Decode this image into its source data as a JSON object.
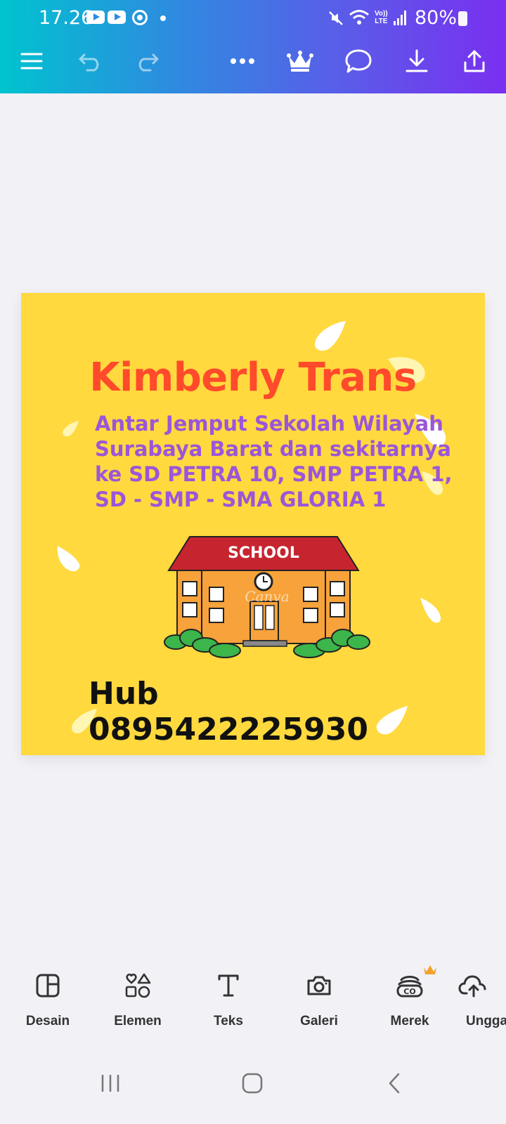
{
  "status": {
    "time": "17.26",
    "battery": "80%",
    "volte_top": "Vo))",
    "volte_bottom": "LTE"
  },
  "toolbar": {
    "menu_icon": "hamburger-icon",
    "undo_icon": "undo-icon",
    "redo_icon": "redo-icon",
    "more_icon": "more-icon",
    "crown_icon": "crown-icon",
    "comment_icon": "comment-icon",
    "download_icon": "download-icon",
    "share_icon": "share-icon"
  },
  "design": {
    "background": "#ffd93e",
    "title": "Kimberly Trans",
    "title_color": "#ff4b2b",
    "subtitle_lines": [
      "Antar Jemput Sekolah Wilayah",
      "Surabaya Barat dan sekitarnya",
      "ke SD PETRA 10, SMP PETRA 1,",
      "SD - SMP - SMA GLORIA 1"
    ],
    "subtitle_color": "#9b56d9",
    "school_sign": "SCHOOL",
    "watermark": "Canva",
    "phone": "Hub 0895422225930"
  },
  "bottom_bar": {
    "items": [
      {
        "label": "Desain",
        "icon": "layout-icon"
      },
      {
        "label": "Elemen",
        "icon": "shapes-icon"
      },
      {
        "label": "Teks",
        "icon": "text-icon"
      },
      {
        "label": "Galeri",
        "icon": "camera-icon"
      },
      {
        "label": "Merek",
        "icon": "brand-icon"
      },
      {
        "label": "Unggah",
        "icon": "upload-cloud-icon"
      }
    ]
  },
  "nav": {
    "recents_icon": "recents-icon",
    "home_icon": "home-icon",
    "back_icon": "back-icon"
  }
}
